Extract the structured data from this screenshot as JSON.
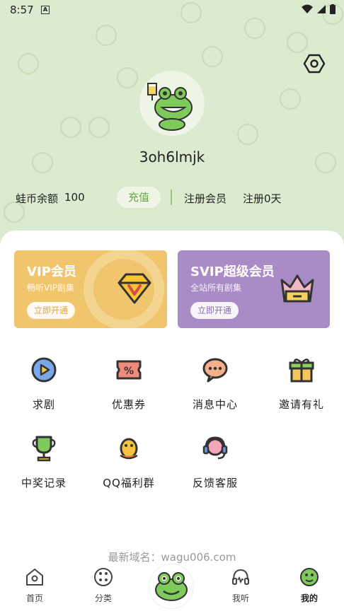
{
  "status_bar": {
    "time": "8:57",
    "notification_icon": "A"
  },
  "profile": {
    "username": "3oh6lmjk"
  },
  "wallet": {
    "coin_label": "蛙币余额",
    "coin_value": "100",
    "recharge_label": "充值",
    "register_label": "注册会员",
    "register_days": "注册0天"
  },
  "vip_card": {
    "title": "VIP会员",
    "subtitle": "畅听VIP剧集",
    "button": "立即开通",
    "color": "#f0c56e"
  },
  "svip_card": {
    "title": "SVIP超级会员",
    "subtitle": "全站所有剧集",
    "button": "立即开通",
    "color": "#a98bc6"
  },
  "menu": [
    {
      "label": "求剧",
      "icon": "play-circle-icon"
    },
    {
      "label": "优惠券",
      "icon": "coupon-icon"
    },
    {
      "label": "消息中心",
      "icon": "message-icon"
    },
    {
      "label": "邀请有礼",
      "icon": "gift-icon"
    },
    {
      "label": "中奖记录",
      "icon": "trophy-icon"
    },
    {
      "label": "QQ福利群",
      "icon": "qq-icon"
    },
    {
      "label": "反馈客服",
      "icon": "headset-icon"
    }
  ],
  "footer": {
    "domain_text": "最新域名：wagu006.com"
  },
  "tabs": [
    {
      "label": "首页",
      "icon": "home-icon"
    },
    {
      "label": "分类",
      "icon": "category-icon"
    },
    {
      "label": "我听",
      "icon": "listen-icon"
    },
    {
      "label": "我的",
      "icon": "mine-icon"
    }
  ],
  "colors": {
    "accent": "#6fa64a",
    "background": "#dcebcf"
  }
}
